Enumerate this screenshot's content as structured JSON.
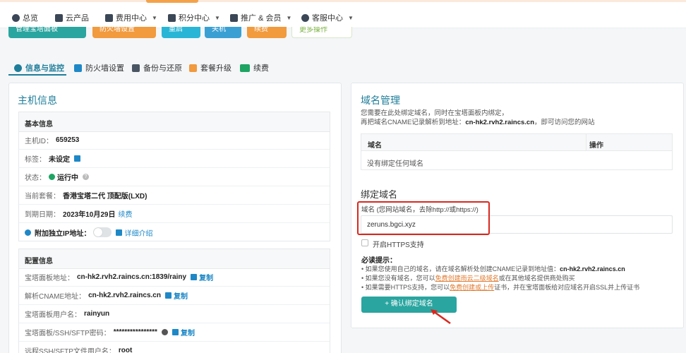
{
  "nav": {
    "items": [
      {
        "label": "总览",
        "icon": "dashboard-icon"
      },
      {
        "label": "云产品",
        "icon": "cloud-icon"
      },
      {
        "label": "费用中心",
        "icon": "wallet-icon"
      },
      {
        "label": "积分中心",
        "icon": "gift-icon"
      },
      {
        "label": "推广 & 会员",
        "icon": "users-icon"
      },
      {
        "label": "客服中心",
        "icon": "headset-icon"
      }
    ]
  },
  "actions": {
    "b1": "管理宝塔面板",
    "b2": "防火墙设置",
    "b3": "重启",
    "b4": "关机",
    "b5": "续费",
    "b6": "更多操作"
  },
  "tabs": [
    {
      "label": "信息与监控"
    },
    {
      "label": "防火墙设置"
    },
    {
      "label": "备份与还原"
    },
    {
      "label": "套餐升级"
    },
    {
      "label": "续费"
    }
  ],
  "host": {
    "title": "主机信息",
    "basic": {
      "head": "基本信息",
      "id_label": "主机ID：",
      "id_value": "659253",
      "tag_label": "标签：",
      "tag_value": "未设定",
      "status_label": "状态：",
      "status_value": "运行中",
      "plan_label": "当前套餐：",
      "plan_value": "香港宝塔二代 顶配版(LXD)",
      "expire_label": "到期日期：",
      "expire_value": "2023年10月29日",
      "renew": "续费",
      "ip_label": "附加独立IP地址：",
      "ip_detail": "详细介绍"
    },
    "config": {
      "head": "配置信息",
      "panel_addr_label": "宝塔面板地址：",
      "panel_addr_value": "cn-hk2.rvh2.raincs.cn:1839/rainy",
      "cname_label": "解析CNAME地址：",
      "cname_value": "cn-hk2.rvh2.raincs.cn",
      "user_label": "宝塔面板用户名：",
      "user_value": "rainyun",
      "pwd_label": "宝塔面板/SSH/SFTP密码：",
      "pwd_value": "****************",
      "ssh_user_label": "远程SSH/SFTP文件用户名：",
      "ssh_user_value": "root",
      "copy": "复制"
    }
  },
  "domain": {
    "title": "域名管理",
    "desc1": "您需要在此处绑定域名，同时在宝塔面板内绑定，",
    "desc2_prefix": "再把域名CNAME记录解析到地址：",
    "desc2_addr": "cn-hk2.rvh2.raincs.cn",
    "desc2_suffix": "，即可访问您的网站",
    "col_domain": "域名",
    "col_action": "操作",
    "empty": "没有绑定任何域名",
    "bind_title": "绑定域名",
    "field_label": "域名 (您网站域名，去除http://或https://)",
    "field_value": "zeruns.bgci.xyz",
    "https_label": "开启HTTPS支持",
    "tips_title": "必读提示：",
    "tip1_prefix": "• 如果您使用自己的域名，请在域名解析处创建CNAME记录到地址值：",
    "tip1_addr": "cn-hk2.rvh2.raincs.cn",
    "tip2_prefix": "• 如果您没有域名，您可以",
    "tip2_link": "免费创建雨云二级域名",
    "tip2_suffix": "或在其他域名提供商处购买",
    "tip3_prefix": "• 如果需要HTTPS支持，您可以",
    "tip3_link": "免费创建或上传",
    "tip3_suffix": "证书，并在宝塔面板给对应域名开启SSL并上传证书",
    "submit": "+ 确认绑定域名"
  },
  "colors": {
    "accent": "#1e7d9a",
    "teal": "#2aa5a0",
    "highlight": "#d9281f"
  }
}
